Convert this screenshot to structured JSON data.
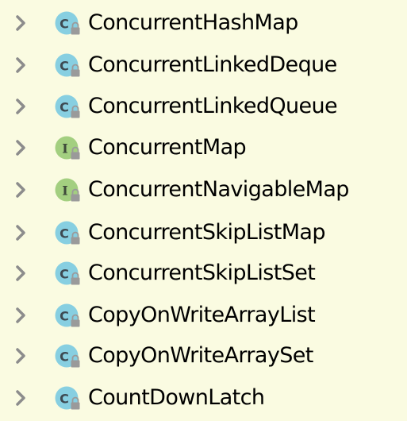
{
  "tree": {
    "items": [
      {
        "label": "ConcurrentHashMap",
        "kind": "class",
        "icon": "class-icon"
      },
      {
        "label": "ConcurrentLinkedDeque",
        "kind": "class",
        "icon": "class-icon"
      },
      {
        "label": "ConcurrentLinkedQueue",
        "kind": "class",
        "icon": "class-icon"
      },
      {
        "label": "ConcurrentMap",
        "kind": "interface",
        "icon": "interface-icon"
      },
      {
        "label": "ConcurrentNavigableMap",
        "kind": "interface",
        "icon": "interface-icon"
      },
      {
        "label": "ConcurrentSkipListMap",
        "kind": "class",
        "icon": "class-icon"
      },
      {
        "label": "ConcurrentSkipListSet",
        "kind": "class",
        "icon": "class-icon"
      },
      {
        "label": "CopyOnWriteArrayList",
        "kind": "class",
        "icon": "class-icon"
      },
      {
        "label": "CopyOnWriteArraySet",
        "kind": "class",
        "icon": "class-icon"
      },
      {
        "label": "CountDownLatch",
        "kind": "class",
        "icon": "class-icon"
      }
    ],
    "icon_letters": {
      "class": "C",
      "interface": "I"
    },
    "colors": {
      "background": "#fafbe1",
      "class_icon": "#87cfe1",
      "interface_icon": "#a3cf80",
      "chevron": "#8c8c8c",
      "lock_overlay": "#9a9a9a"
    }
  }
}
